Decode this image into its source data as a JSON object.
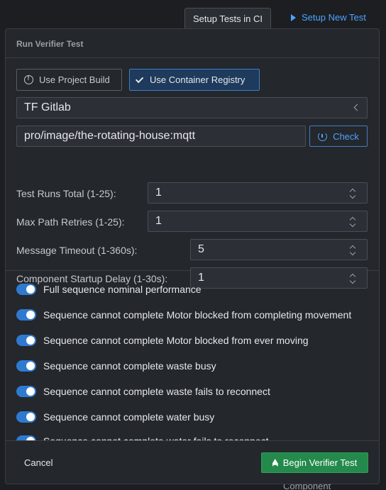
{
  "background": {
    "setup_ci_label": "Setup Tests in CI",
    "setup_new_label": "Setup New Test",
    "bottom_labels": [
      "Component"
    ]
  },
  "modal": {
    "title": "Run Verifier Test",
    "source_options": {
      "project_build": "Use Project Build",
      "container_registry": "Use Container Registry",
      "selected": "container_registry"
    },
    "registry_select": "TF Gitlab",
    "image_value": "pro/image/the-rotating-house:mqtt",
    "check_label": "Check",
    "fields": [
      {
        "label": "Test Runs Total (1-25):",
        "value": "1"
      },
      {
        "label": "Max Path Retries (1-25):",
        "value": "1"
      },
      {
        "label": "Message Timeout (1-360s):",
        "value": "5"
      },
      {
        "label": "Component Startup Delay (1-30s):",
        "value": "1"
      }
    ],
    "tests": [
      {
        "label": "Full sequence nominal performance",
        "enabled": true
      },
      {
        "label": "Sequence cannot complete Motor blocked from completing movement",
        "enabled": true
      },
      {
        "label": "Sequence cannot complete Motor blocked from ever moving",
        "enabled": true
      },
      {
        "label": "Sequence cannot complete waste busy",
        "enabled": true
      },
      {
        "label": "Sequence cannot complete waste fails to reconnect",
        "enabled": true
      },
      {
        "label": "Sequence cannot complete water busy",
        "enabled": true
      },
      {
        "label": "Sequence cannot complete water fails to reconnect",
        "enabled": true
      }
    ],
    "cancel_label": "Cancel",
    "begin_label": "Begin Verifier Test"
  },
  "colors": {
    "accent": "#2f7ad1",
    "link": "#4da3ff",
    "primary_action": "#238a4c"
  }
}
